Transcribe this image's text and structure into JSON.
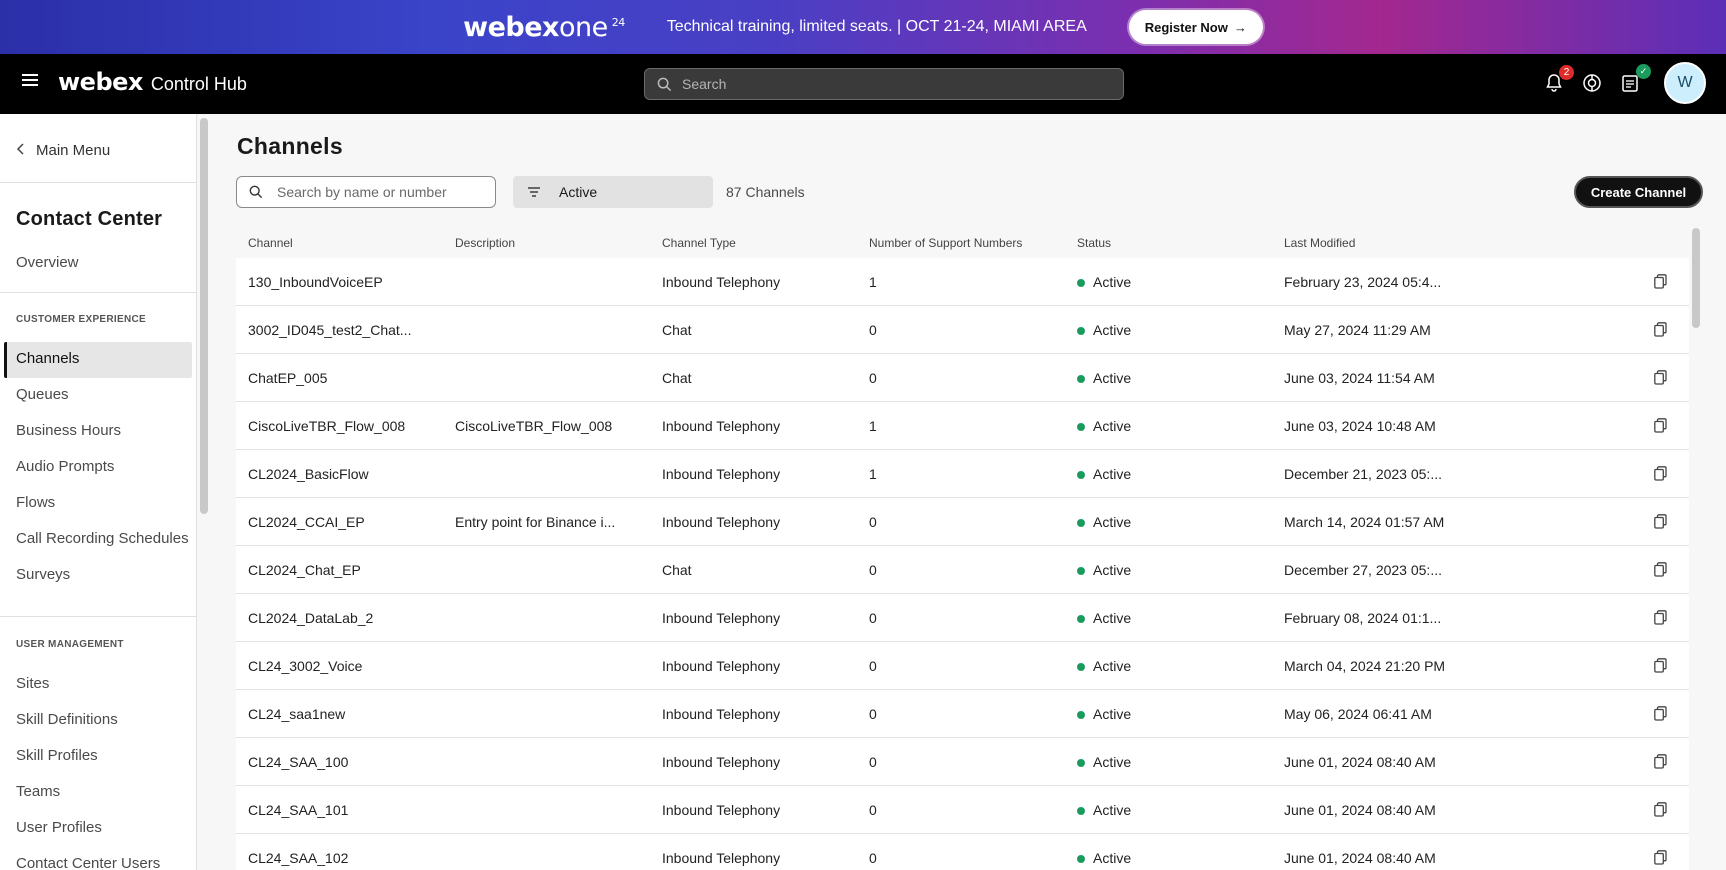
{
  "banner": {
    "logo_main": "webex",
    "logo_one": "one",
    "logo_sup": "24",
    "text": "Technical training, limited seats. | OCT 21-24, MIAMI AREA",
    "cta_label": "Register Now",
    "cta_icon": "arrow-right-icon"
  },
  "header": {
    "brand": "webex",
    "product": "Control Hub",
    "search_placeholder": "Search",
    "notifications_count": "2",
    "avatar_initial": "W"
  },
  "sidebar": {
    "back_label": "Main Menu",
    "title": "Contact Center",
    "overview": "Overview",
    "section_customer": "CUSTOMER EXPERIENCE",
    "customer_items": [
      "Channels",
      "Queues",
      "Business Hours",
      "Audio Prompts",
      "Flows",
      "Call Recording Schedules",
      "Surveys"
    ],
    "section_user": "USER MANAGEMENT",
    "user_items": [
      "Sites",
      "Skill Definitions",
      "Skill Profiles",
      "Teams",
      "User Profiles",
      "Contact Center Users"
    ],
    "active_item": "Channels"
  },
  "main": {
    "title": "Channels",
    "search_placeholder": "Search by name or number",
    "status_filter": "Active",
    "count": "87 Channels",
    "create_button": "Create Channel"
  },
  "table": {
    "columns": [
      "Channel",
      "Description",
      "Channel Type",
      "Number of Support Numbers",
      "Status",
      "Last Modified"
    ],
    "rows": [
      {
        "channel": "130_InboundVoiceEP",
        "description": "",
        "type": "Inbound Telephony",
        "numbers": "1",
        "status": "Active",
        "modified": "February 23, 2024 05:4..."
      },
      {
        "channel": "3002_ID045_test2_Chat...",
        "description": "",
        "type": "Chat",
        "numbers": "0",
        "status": "Active",
        "modified": "May 27, 2024 11:29 AM"
      },
      {
        "channel": "ChatEP_005",
        "description": "",
        "type": "Chat",
        "numbers": "0",
        "status": "Active",
        "modified": "June 03, 2024 11:54 AM"
      },
      {
        "channel": "CiscoLiveTBR_Flow_008",
        "description": "CiscoLiveTBR_Flow_008",
        "type": "Inbound Telephony",
        "numbers": "1",
        "status": "Active",
        "modified": "June 03, 2024 10:48 AM"
      },
      {
        "channel": "CL2024_BasicFlow",
        "description": "",
        "type": "Inbound Telephony",
        "numbers": "1",
        "status": "Active",
        "modified": "December 21, 2023 05:..."
      },
      {
        "channel": "CL2024_CCAI_EP",
        "description": "Entry point for Binance i...",
        "type": "Inbound Telephony",
        "numbers": "0",
        "status": "Active",
        "modified": "March 14, 2024 01:57 AM"
      },
      {
        "channel": "CL2024_Chat_EP",
        "description": "",
        "type": "Chat",
        "numbers": "0",
        "status": "Active",
        "modified": "December 27, 2023 05:..."
      },
      {
        "channel": "CL2024_DataLab_2",
        "description": "",
        "type": "Inbound Telephony",
        "numbers": "0",
        "status": "Active",
        "modified": "February 08, 2024 01:1..."
      },
      {
        "channel": "CL24_3002_Voice",
        "description": "",
        "type": "Inbound Telephony",
        "numbers": "0",
        "status": "Active",
        "modified": "March 04, 2024 21:20 PM"
      },
      {
        "channel": "CL24_saa1new",
        "description": "",
        "type": "Inbound Telephony",
        "numbers": "0",
        "status": "Active",
        "modified": "May 06, 2024 06:41 AM"
      },
      {
        "channel": "CL24_SAA_100",
        "description": "",
        "type": "Inbound Telephony",
        "numbers": "0",
        "status": "Active",
        "modified": "June 01, 2024 08:40 AM"
      },
      {
        "channel": "CL24_SAA_101",
        "description": "",
        "type": "Inbound Telephony",
        "numbers": "0",
        "status": "Active",
        "modified": "June 01, 2024 08:40 AM"
      },
      {
        "channel": "CL24_SAA_102",
        "description": "",
        "type": "Inbound Telephony",
        "numbers": "0",
        "status": "Active",
        "modified": "June 01, 2024 08:40 AM"
      }
    ]
  },
  "colors": {
    "status_active": "#1c9b5e",
    "notification_badge": "#e02b2b",
    "avatar_bg": "#cdeefc"
  }
}
